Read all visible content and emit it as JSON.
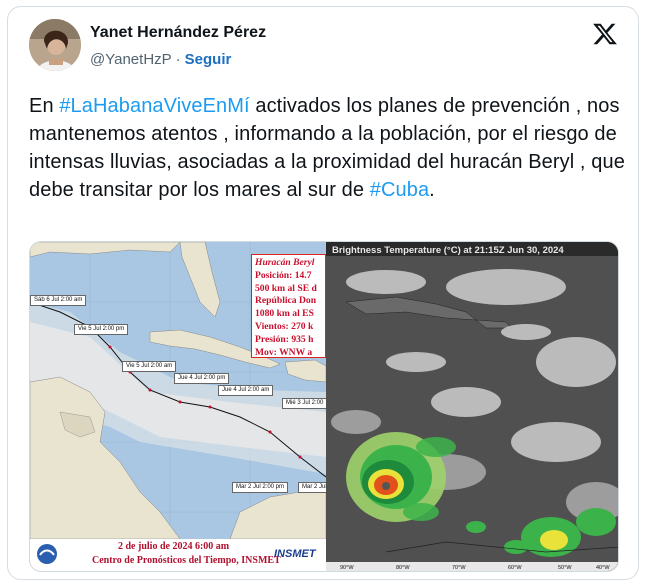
{
  "tweet": {
    "author_name": "Yanet Hernández Pérez",
    "handle": "@YanetHzP",
    "separator": "·",
    "follow_label": "Seguir",
    "text": {
      "t1": "En ",
      "hashtag1": "#LaHabanaViveEnMí",
      "t2": "  activados los planes de prevención , nos mantenemos atentos , informando a la población, por el riesgo de intensas lluvias, asociadas a la proximidad  del huracán Beryl , que debe  transitar por los mares al sur de ",
      "hashtag2": "#Cuba",
      "t3": "."
    }
  },
  "icons": {
    "logo": "x-logo-icon",
    "avatar": "profile-photo"
  },
  "colors": {
    "hashtag": "#1d9bf0",
    "follow": "#1d6fc2",
    "text": "#0f1419",
    "secondary": "#536471"
  },
  "forecast_map": {
    "info_lines": [
      "Huracán Beryl",
      "Posición:  14.7",
      "500 km al SE d",
      "República Don",
      "1080 km al ES",
      "Vientos: 270 k",
      "Presión: 935 h",
      "Mov: WNW a"
    ],
    "forecast_labels": [
      "Sáb 6 Jul 2:00 am",
      "Vie 5 Jul 2:00 pm",
      "Vie 5 Jul 2:00 am",
      "Jue 4 Jul 2:00 pm",
      "Jue 4 Jul 2:00 am",
      "Mié 3 Jul 2:00",
      "Mar 2 Jul 2:00 pm",
      "Mar 2 Jul 2:00 am"
    ],
    "date": "2 de julio de 2024   6:00 am",
    "center": "Centro de Pronósticos del Tiempo, INSMET",
    "logo_text": "INSMET"
  },
  "satellite": {
    "title": "Brightness Temperature (°C) at 21:15Z Jun 30, 2024",
    "lon_labels": [
      "90°W",
      "80°W",
      "70°W",
      "60°W",
      "50°W",
      "40°W"
    ]
  }
}
